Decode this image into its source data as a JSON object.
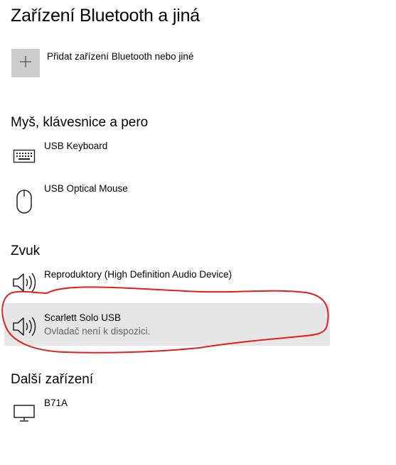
{
  "page": {
    "title": "Zařízení Bluetooth a jiná"
  },
  "add_device": {
    "label": "Přidat zařízení Bluetooth nebo jiné",
    "icon": "plus-icon"
  },
  "sections": {
    "input": {
      "title": "Myš, klávesnice a pero",
      "devices": [
        {
          "name": "USB Keyboard",
          "icon": "keyboard-icon"
        },
        {
          "name": "USB Optical Mouse",
          "icon": "mouse-icon"
        }
      ]
    },
    "audio": {
      "title": "Zvuk",
      "devices": [
        {
          "name": "Reproduktory (High Definition Audio Device)",
          "icon": "speaker-icon"
        },
        {
          "name": "Scarlett Solo USB",
          "status": "Ovladač není k dispozici.",
          "icon": "speaker-icon"
        }
      ]
    },
    "other": {
      "title": "Další zařízení",
      "devices": [
        {
          "name": "B71A",
          "icon": "monitor-icon"
        }
      ]
    }
  },
  "colors": {
    "selected_bg": "#e6e6e6",
    "add_tile": "#cccccc",
    "annotation": "#e02020",
    "secondary_text": "#666666"
  }
}
